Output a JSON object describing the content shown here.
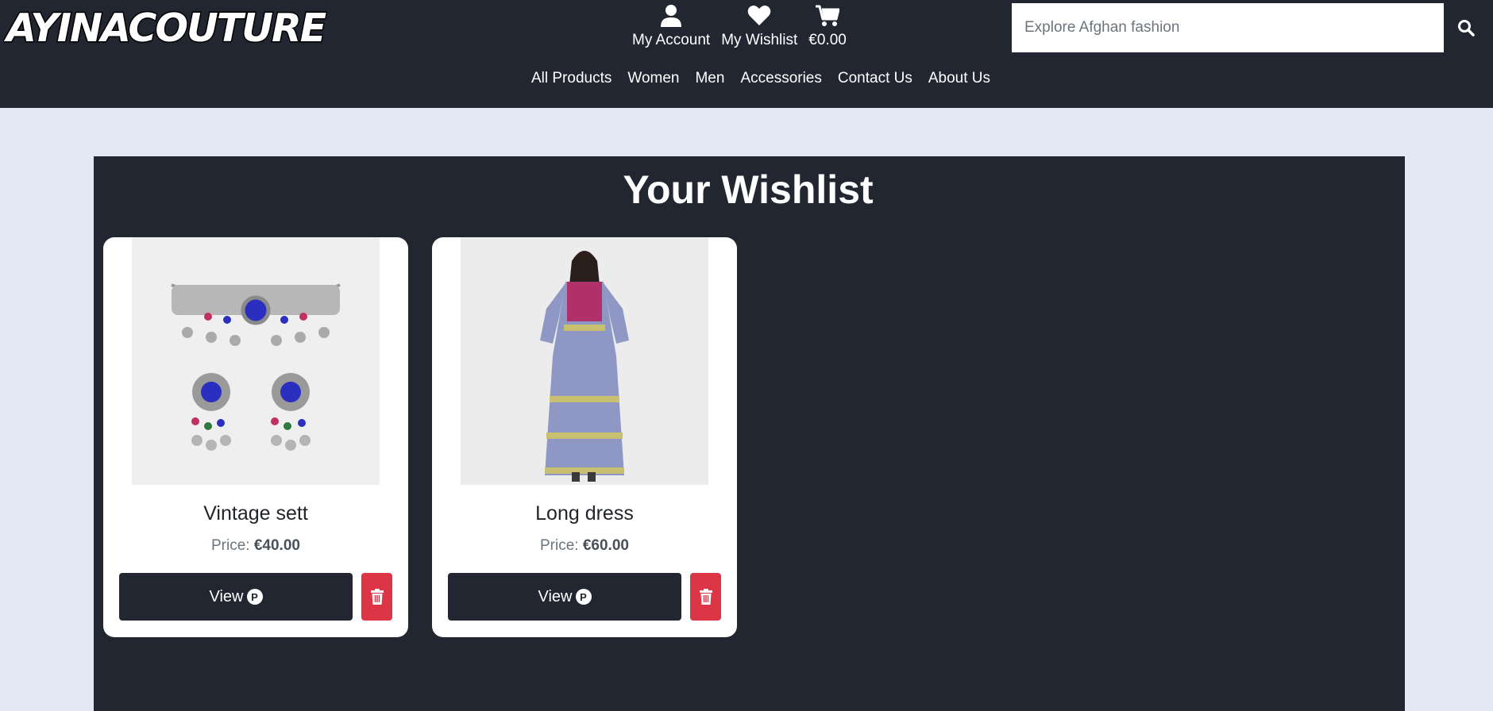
{
  "header": {
    "logo_text": "AYINACOUTURE",
    "account_label": "My Account",
    "wishlist_label": "My Wishlist",
    "cart_total": "€0.00",
    "search_placeholder": "Explore Afghan fashion"
  },
  "nav": {
    "items": [
      "All Products",
      "Women",
      "Men",
      "Accessories",
      "Contact Us",
      "About Us"
    ]
  },
  "wishlist": {
    "title": "Your Wishlist",
    "price_prefix": "Price:",
    "view_label": "View",
    "view_badge": "P",
    "items": [
      {
        "name": "Vintage sett",
        "price": "€40.00"
      },
      {
        "name": "Long dress",
        "price": "€60.00"
      }
    ]
  },
  "colors": {
    "header_bg": "#212631",
    "page_bg": "#e3e9f4",
    "delete_red": "#dc3545"
  }
}
